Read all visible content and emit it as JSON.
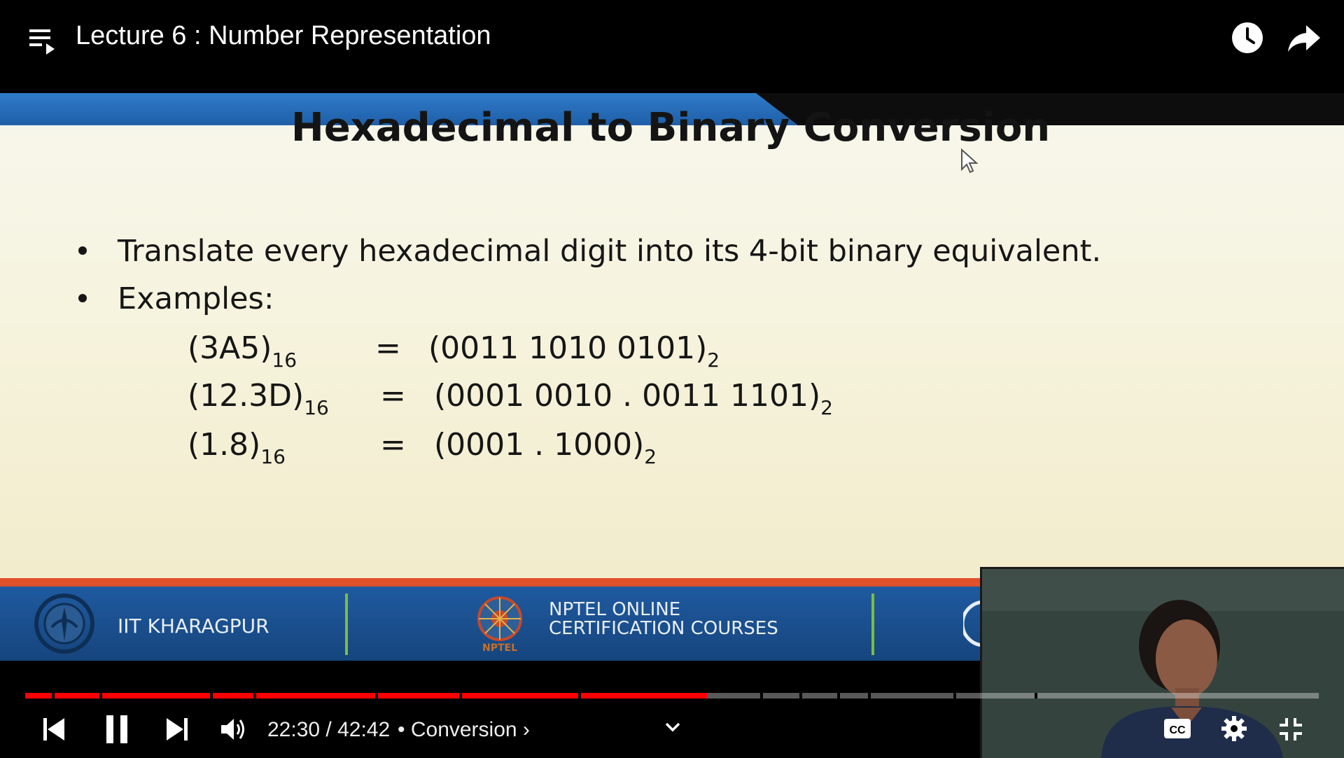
{
  "player": {
    "title": "Lecture 6 : Number Representation",
    "current_time": "22:30",
    "duration": "42:42",
    "time_display": "22:30 / 42:42",
    "chapter_label": "• Conversion ›",
    "progress_fraction": 0.527,
    "accent_color": "#ff0000"
  },
  "slide": {
    "heading": "Hexadecimal to Binary Conversion",
    "bullets": [
      "Translate every hexadecimal digit into its 4-bit binary equivalent.",
      "Examples:"
    ],
    "examples": [
      {
        "lhs": "(3A5)",
        "lhs_base": "16",
        "eq": "=",
        "rhs": "(0011 1010 0101)",
        "rhs_base": "2"
      },
      {
        "lhs": "(12.3D)",
        "lhs_base": "16",
        "eq": "=",
        "rhs": "(0001 0010 . 0011 1101)",
        "rhs_base": "2"
      },
      {
        "lhs": "(1.8)",
        "lhs_base": "16",
        "eq": "=",
        "rhs": "(0001 . 1000)",
        "rhs_base": "2"
      }
    ],
    "footer": {
      "institute": "IIT KHARAGPUR",
      "nptel_line1": "NPTEL ONLINE",
      "nptel_line2": "CERTIFICATION COURSES",
      "nptel_logo_text": "NPTEL"
    }
  },
  "icons": {
    "playlist": "playlist-icon",
    "watch_later": "clock-icon",
    "share": "share-arrow-icon",
    "previous": "skip-previous-icon",
    "pause": "pause-icon",
    "next": "skip-next-icon",
    "volume": "volume-icon",
    "captions": "cc-icon",
    "settings": "gear-icon",
    "exit_fullscreen": "exit-fullscreen-icon"
  }
}
